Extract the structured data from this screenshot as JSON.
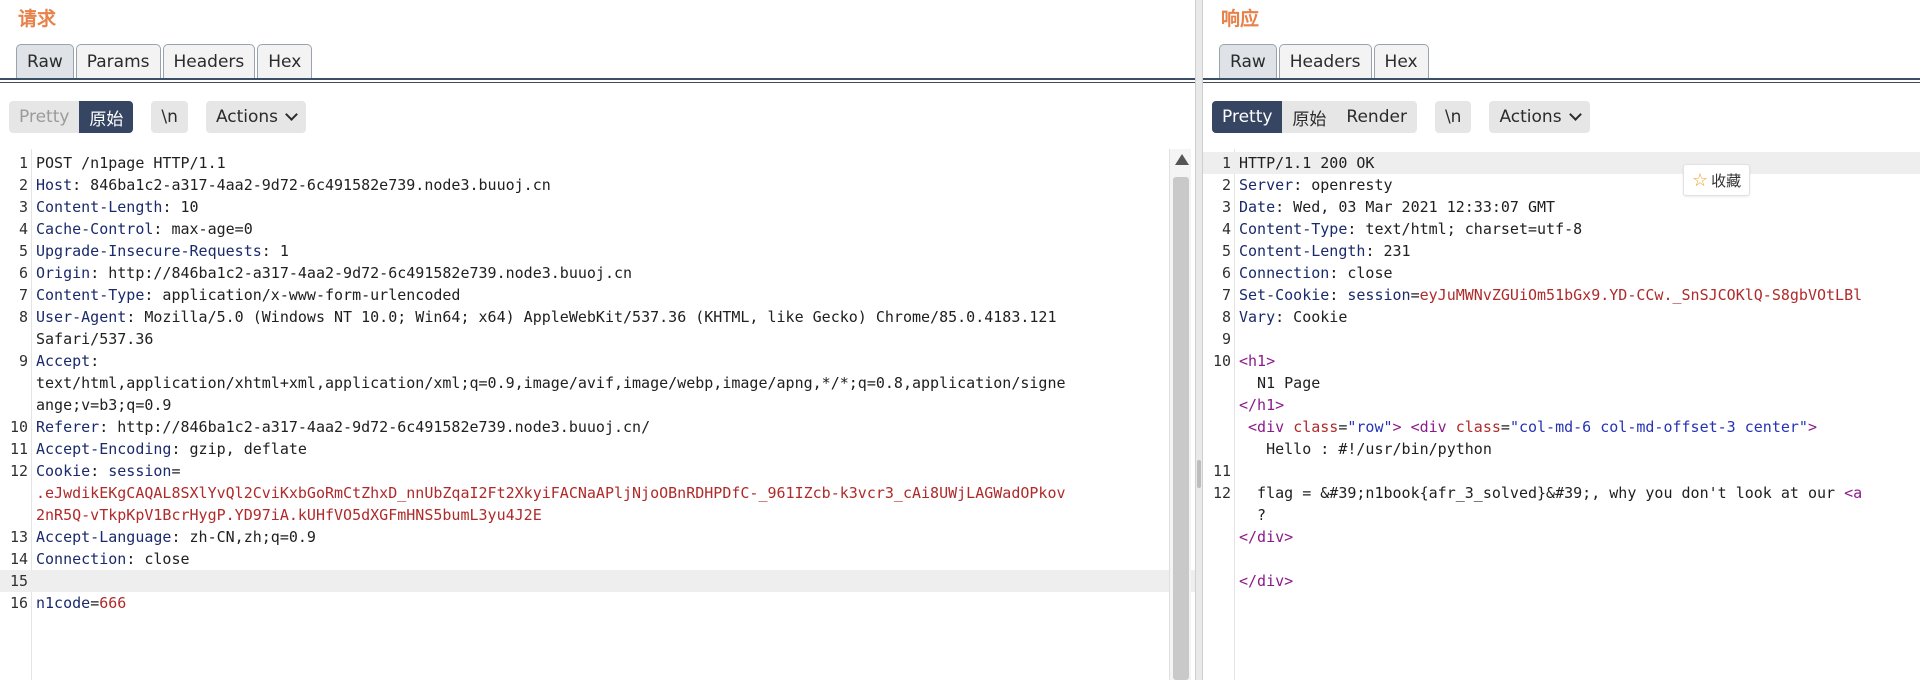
{
  "request": {
    "title": "请求",
    "tabs": [
      "Raw",
      "Params",
      "Headers",
      "Hex"
    ],
    "toolbar": {
      "pretty": "Pretty",
      "raw": "原始",
      "newline": "\\n",
      "actions": "Actions"
    },
    "lines": [
      {
        "n": "1",
        "parts": [
          [
            "v",
            "POST /n1page HTTP/1.1"
          ]
        ]
      },
      {
        "n": "2",
        "parts": [
          [
            "k",
            "Host"
          ],
          [
            "v",
            ": 846ba1c2-a317-4aa2-9d72-6c491582e739.node3.buuoj.cn"
          ]
        ]
      },
      {
        "n": "3",
        "parts": [
          [
            "k",
            "Content-Length"
          ],
          [
            "v",
            ": 10"
          ]
        ]
      },
      {
        "n": "4",
        "parts": [
          [
            "k",
            "Cache-Control"
          ],
          [
            "v",
            ": max-age=0"
          ]
        ]
      },
      {
        "n": "5",
        "parts": [
          [
            "k",
            "Upgrade-Insecure-Requests"
          ],
          [
            "v",
            ": 1"
          ]
        ]
      },
      {
        "n": "6",
        "parts": [
          [
            "k",
            "Origin"
          ],
          [
            "v",
            ": http://846ba1c2-a317-4aa2-9d72-6c491582e739.node3.buuoj.cn"
          ]
        ]
      },
      {
        "n": "7",
        "parts": [
          [
            "k",
            "Content-Type"
          ],
          [
            "v",
            ": application/x-www-form-urlencoded"
          ]
        ]
      },
      {
        "n": "8",
        "parts": [
          [
            "k",
            "User-Agent"
          ],
          [
            "v",
            ": Mozilla/5.0 (Windows NT 10.0; Win64; x64) AppleWebKit/537.36 (KHTML, like Gecko) Chrome/85.0.4183.121"
          ]
        ]
      },
      {
        "n": "",
        "parts": [
          [
            "v",
            "Safari/537.36"
          ]
        ]
      },
      {
        "n": "9",
        "parts": [
          [
            "k",
            "Accept"
          ],
          [
            "v",
            ":"
          ]
        ]
      },
      {
        "n": "",
        "parts": [
          [
            "v",
            "text/html,application/xhtml+xml,application/xml;q=0.9,image/avif,image/webp,image/apng,*/*;q=0.8,application/signe"
          ]
        ]
      },
      {
        "n": "",
        "parts": [
          [
            "v",
            "ange;v=b3;q=0.9"
          ]
        ]
      },
      {
        "n": "10",
        "parts": [
          [
            "k",
            "Referer"
          ],
          [
            "v",
            ": http://846ba1c2-a317-4aa2-9d72-6c491582e739.node3.buuoj.cn/"
          ]
        ]
      },
      {
        "n": "11",
        "parts": [
          [
            "k",
            "Accept-Encoding"
          ],
          [
            "v",
            ": gzip, deflate"
          ]
        ]
      },
      {
        "n": "12",
        "parts": [
          [
            "k",
            "Cookie"
          ],
          [
            "v",
            ": "
          ],
          [
            "k",
            "session"
          ],
          [
            "v",
            "="
          ]
        ]
      },
      {
        "n": "",
        "parts": [
          [
            "r",
            ".eJwdikEKgCAQAL8SXlYvQl2CviKxbGoRmCtZhxD_nnUbZqaI2Ft2XkyiFACNaAPljNjoOBnRDHPDfC-_961IZcb-k3vcr3_cAi8UWjLAGWadOPkov"
          ]
        ]
      },
      {
        "n": "",
        "parts": [
          [
            "r",
            "2nR5Q-vTkpKpV1BcrHygP.YD97iA.kUHfVO5dXGFmHNS5bumL3yu4J2E"
          ]
        ]
      },
      {
        "n": "13",
        "parts": [
          [
            "k",
            "Accept-Language"
          ],
          [
            "v",
            ": zh-CN,zh;q=0.9"
          ]
        ]
      },
      {
        "n": "14",
        "parts": [
          [
            "k",
            "Connection"
          ],
          [
            "v",
            ": close"
          ]
        ]
      },
      {
        "n": "15",
        "parts": [
          [
            "v",
            ""
          ]
        ],
        "hl": true
      },
      {
        "n": "16",
        "parts": [
          [
            "k",
            "n1code"
          ],
          [
            "v",
            "="
          ],
          [
            "r",
            "666"
          ]
        ]
      }
    ]
  },
  "response": {
    "title": "响应",
    "tabs": [
      "Raw",
      "Headers",
      "Hex"
    ],
    "toolbar": {
      "pretty": "Pretty",
      "raw": "原始",
      "render": "Render",
      "newline": "\\n",
      "actions": "Actions"
    },
    "favorite": "收藏",
    "lines": [
      {
        "n": "1",
        "parts": [
          [
            "v",
            "HTTP/1.1 200 OK"
          ]
        ],
        "hl": true
      },
      {
        "n": "2",
        "parts": [
          [
            "k",
            "Server"
          ],
          [
            "v",
            ": openresty"
          ]
        ]
      },
      {
        "n": "3",
        "parts": [
          [
            "k",
            "Date"
          ],
          [
            "v",
            ": Wed, 03 Mar 2021 12:33:07 GMT"
          ]
        ]
      },
      {
        "n": "4",
        "parts": [
          [
            "k",
            "Content-Type"
          ],
          [
            "v",
            ": text/html; charset=utf-8"
          ]
        ]
      },
      {
        "n": "5",
        "parts": [
          [
            "k",
            "Content-Length"
          ],
          [
            "v",
            ": 231"
          ]
        ]
      },
      {
        "n": "6",
        "parts": [
          [
            "k",
            "Connection"
          ],
          [
            "v",
            ": close"
          ]
        ]
      },
      {
        "n": "7",
        "parts": [
          [
            "k",
            "Set-Cookie"
          ],
          [
            "v",
            ": "
          ],
          [
            "k",
            "session"
          ],
          [
            "v",
            "="
          ],
          [
            "r",
            "eyJuMWNvZGUiOm51bGx9.YD-CCw._SnSJCOKlQ-S8gbVOtLBl"
          ]
        ]
      },
      {
        "n": "8",
        "parts": [
          [
            "k",
            "Vary"
          ],
          [
            "v",
            ": Cookie"
          ]
        ]
      },
      {
        "n": "9",
        "parts": [
          [
            "v",
            ""
          ]
        ]
      },
      {
        "n": "10",
        "parts": [
          [
            "tag",
            "<h1>"
          ]
        ]
      },
      {
        "n": "",
        "parts": [
          [
            "v",
            "  N1 Page"
          ]
        ]
      },
      {
        "n": "",
        "parts": [
          [
            "tag",
            "</h1>"
          ]
        ]
      },
      {
        "n": "",
        "parts": [
          [
            "tag",
            " <div "
          ],
          [
            "attr",
            "class"
          ],
          [
            "v",
            "="
          ],
          [
            "str",
            "\"row\""
          ],
          [
            "tag",
            "> <div "
          ],
          [
            "attr",
            "class"
          ],
          [
            "v",
            "="
          ],
          [
            "str",
            "\"col-md-6 col-md-offset-3 center\""
          ],
          [
            "tag",
            ">"
          ]
        ]
      },
      {
        "n": "",
        "parts": [
          [
            "v",
            "   Hello : #!/usr/bin/python"
          ]
        ]
      },
      {
        "n": "11",
        "parts": [
          [
            "v",
            ""
          ]
        ]
      },
      {
        "n": "12",
        "parts": [
          [
            "v",
            "  flag = &#39;n1book{afr_3_solved}&#39;, why you don't look at our "
          ],
          [
            "tag",
            "<a"
          ]
        ]
      },
      {
        "n": "",
        "parts": [
          [
            "v",
            "  ?"
          ]
        ]
      },
      {
        "n": "",
        "parts": [
          [
            "tag",
            "</div>"
          ]
        ]
      },
      {
        "n": "",
        "parts": [
          [
            "v",
            ""
          ]
        ]
      },
      {
        "n": "",
        "parts": [
          [
            "tag",
            "</div>"
          ]
        ]
      }
    ]
  }
}
